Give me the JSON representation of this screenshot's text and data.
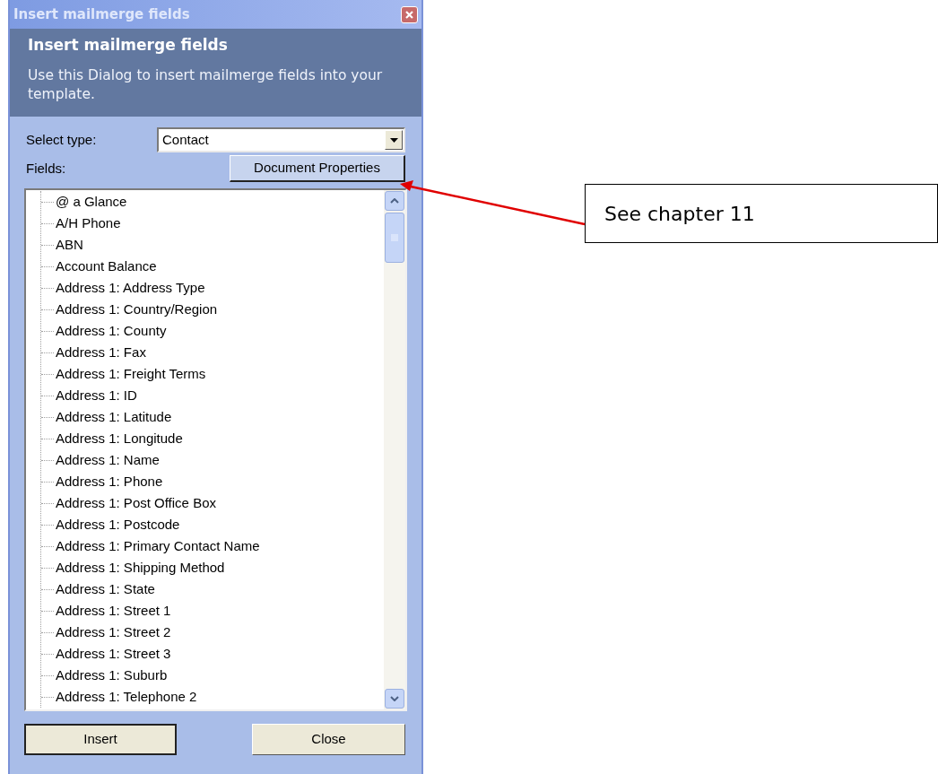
{
  "window": {
    "title": "Insert mailmerge fields"
  },
  "header": {
    "title": "Insert mailmerge fields",
    "description": "Use this Dialog to insert mailmerge fields into your template."
  },
  "select_type": {
    "label": "Select type:",
    "value": "Contact"
  },
  "document_properties_button": "Document Properties",
  "fields": {
    "label": "Fields:",
    "items": [
      "@ a Glance",
      "A/H Phone",
      "ABN",
      "Account Balance",
      "Address 1: Address Type",
      "Address 1: Country/Region",
      "Address 1: County",
      "Address 1: Fax",
      "Address 1: Freight Terms",
      "Address 1: ID",
      "Address 1: Latitude",
      "Address 1: Longitude",
      "Address 1: Name",
      "Address 1: Phone",
      "Address 1: Post Office Box",
      "Address 1: Postcode",
      "Address 1: Primary Contact Name",
      "Address 1: Shipping Method",
      "Address 1: State",
      "Address 1: Street 1",
      "Address 1: Street 2",
      "Address 1: Street 3",
      "Address 1: Suburb",
      "Address 1: Telephone 2"
    ]
  },
  "buttons": [
    {
      "label": "Insert",
      "default": true
    },
    {
      "label": "Close",
      "default": false
    }
  ],
  "callout": {
    "text": "See chapter 11"
  }
}
